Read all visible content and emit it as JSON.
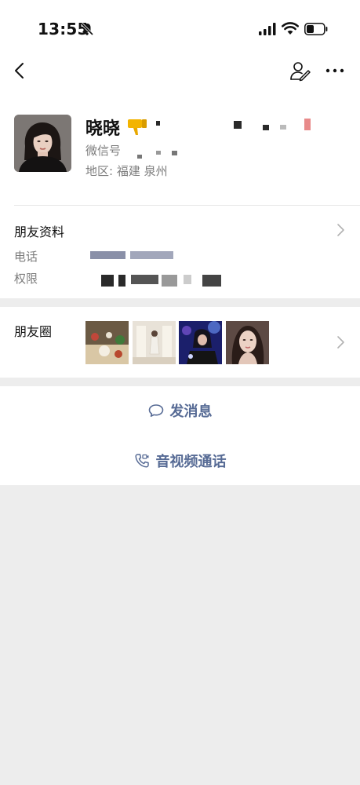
{
  "status_bar": {
    "time": "13:55",
    "icons": [
      "bell-slash-icon",
      "signal-icon",
      "wifi-icon",
      "battery-icon"
    ]
  },
  "nav": {
    "back_icon": "chevron-left-icon",
    "edit_icon": "edit-contact-icon",
    "more_icon": "more-dots-icon"
  },
  "profile": {
    "name": "晓晓",
    "wechat_id_label": "微信号",
    "region": "地区: 福建 泉州"
  },
  "info": {
    "title": "朋友资料",
    "phone_label": "电话",
    "permission_label": "权限"
  },
  "moments": {
    "title": "朋友圈"
  },
  "actions": {
    "send_message": "发消息",
    "video_call": "音视频通话"
  },
  "colors": {
    "link": "#576b95",
    "background": "#ededed",
    "secondary_text": "#7d7d7d"
  }
}
